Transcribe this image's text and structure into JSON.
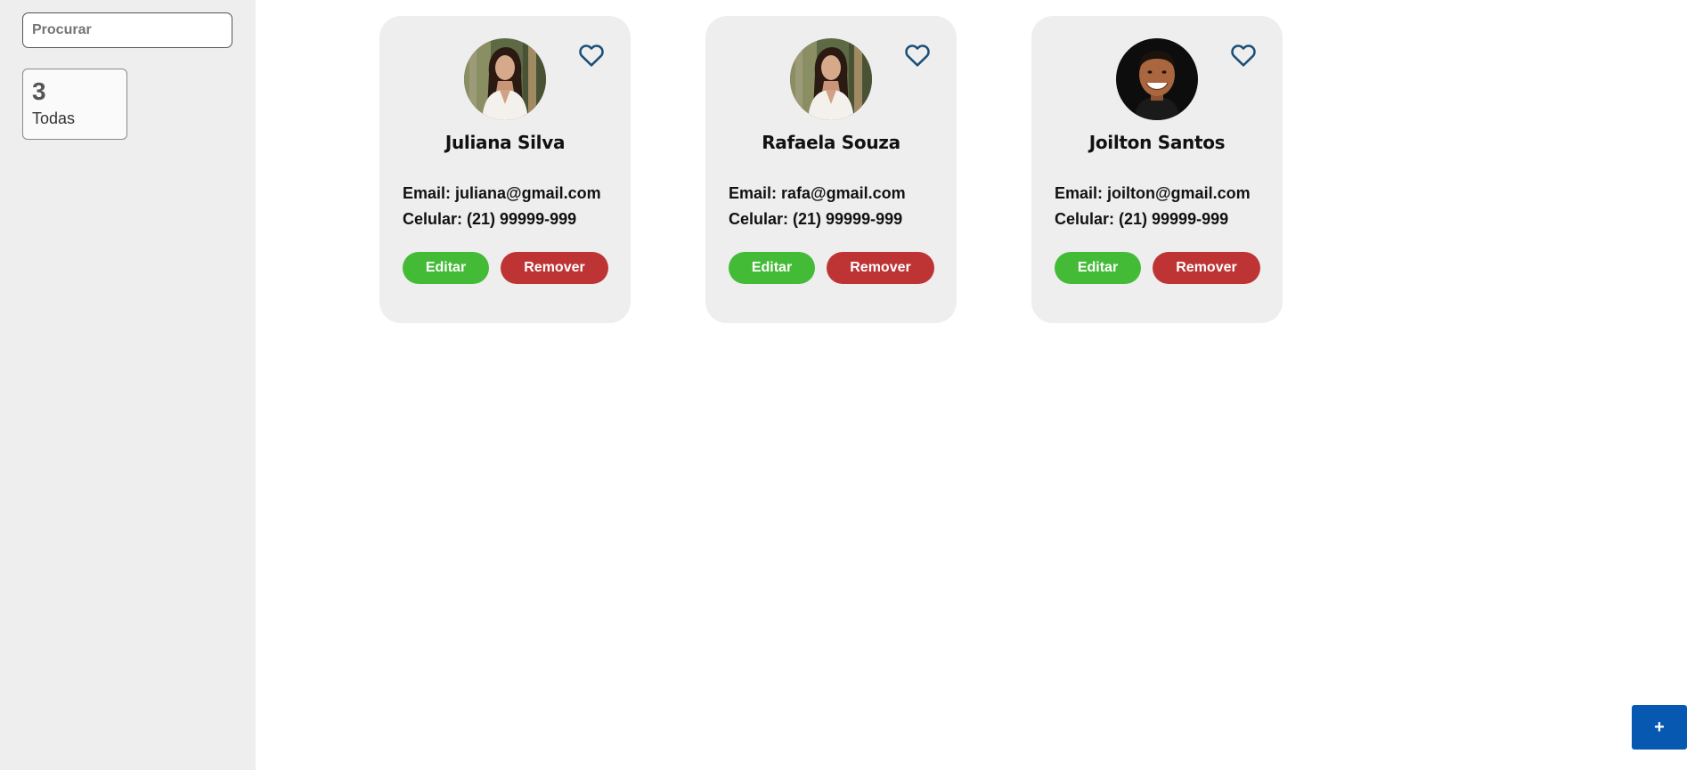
{
  "sidebar": {
    "search": {
      "placeholder": "Procurar",
      "value": ""
    },
    "filter": {
      "count": "3",
      "label": "Todas"
    }
  },
  "contacts": [
    {
      "name": "Juliana Silva",
      "email_line": "Email: juliana@gmail.com",
      "phone_line": "Celular: (21) 99999-999",
      "avatar": "woman-long-dark-hair-photo",
      "favorite_icon": "heart-outline-icon",
      "edit_label": "Editar",
      "remove_label": "Remover"
    },
    {
      "name": "Rafaela Souza",
      "email_line": "Email: rafa@gmail.com",
      "phone_line": "Celular: (21) 99999-999",
      "avatar": "woman-long-dark-hair-photo",
      "favorite_icon": "heart-outline-icon",
      "edit_label": "Editar",
      "remove_label": "Remover"
    },
    {
      "name": "Joilton Santos",
      "email_line": "Email: joilton@gmail.com",
      "phone_line": "Celular: (21) 99999-999",
      "avatar": "smiling-man-photo",
      "favorite_icon": "heart-outline-icon",
      "edit_label": "Editar",
      "remove_label": "Remover"
    }
  ],
  "fab": {
    "label": "+"
  },
  "colors": {
    "sidebar_bg": "#eeeeee",
    "card_bg": "#eeeeee",
    "edit_button": "#44bb37",
    "remove_button": "#be3434",
    "heart_icon": "#1b4f78",
    "fab": "#0758b0"
  }
}
